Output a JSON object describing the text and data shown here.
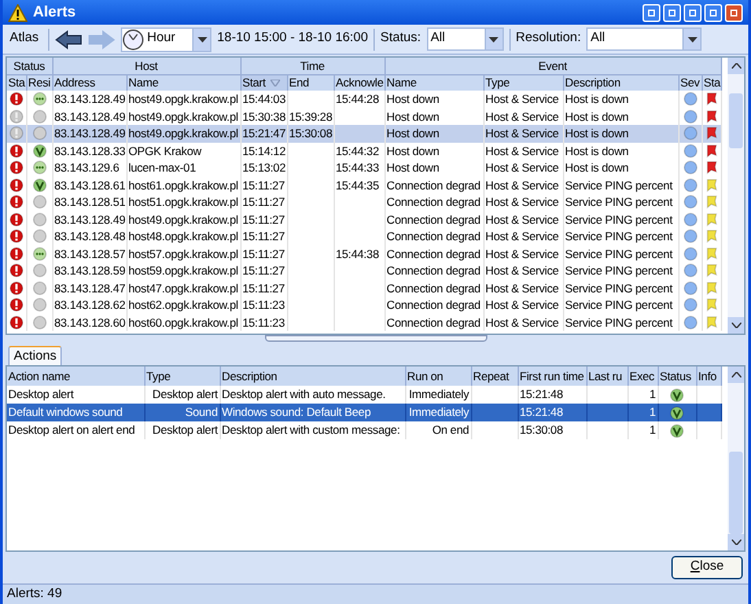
{
  "window": {
    "title": "Alerts"
  },
  "toolbar": {
    "atlas": "Atlas",
    "back_disabled": false,
    "forward_disabled": true,
    "period": "Hour",
    "range": "18-10 15:00 - 18-10 16:00",
    "status_label": "Status:",
    "status_value": "All",
    "resolution_label": "Resolution:",
    "resolution_value": "All"
  },
  "alerts_table": {
    "groups": [
      {
        "label": "Status",
        "columns": [
          {
            "label": "Sta",
            "sorted": false
          },
          {
            "label": "Resi",
            "sorted": false
          }
        ]
      },
      {
        "label": "Host",
        "columns": [
          {
            "label": "Address",
            "sorted": false
          },
          {
            "label": "Name",
            "sorted": false
          }
        ]
      },
      {
        "label": "Time",
        "columns": [
          {
            "label": "Start",
            "sorted": true
          },
          {
            "label": "End",
            "sorted": false
          },
          {
            "label": "Acknowle",
            "sorted": false
          }
        ]
      },
      {
        "label": "Event",
        "columns": [
          {
            "label": "Name",
            "sorted": false
          },
          {
            "label": "Type",
            "sorted": false
          },
          {
            "label": "Description",
            "sorted": false
          },
          {
            "label": "Sev",
            "sorted": false
          },
          {
            "label": "Sta",
            "sorted": false
          }
        ]
      }
    ],
    "rows": [
      {
        "status": {
          "kind": "critical"
        },
        "resolution": {
          "kind": "acknowledged"
        },
        "address": "83.143.128.49",
        "name": "host49.opgk.krakow.pl",
        "start": "15:44:03",
        "acknowledged": "15:44:28",
        "event": "Host down",
        "type": "Host & Service",
        "description": "Host is down",
        "state": {
          "kind": "down"
        },
        "selected": false
      },
      {
        "status": {
          "kind": "inactive"
        },
        "resolution": {
          "kind": "none"
        },
        "address": "83.143.128.49",
        "name": "host49.opgk.krakow.pl",
        "start": "15:30:38",
        "end": "15:39:28",
        "event": "Host down",
        "type": "Host & Service",
        "description": "Host is down",
        "state": {
          "kind": "down"
        },
        "selected": false
      },
      {
        "status": {
          "kind": "inactive"
        },
        "resolution": {
          "kind": "none"
        },
        "address": "83.143.128.49",
        "name": "host49.opgk.krakow.pl",
        "start": "15:21:47",
        "end": "15:30:08",
        "event": "Host down",
        "type": "Host & Service",
        "description": "Host is down",
        "state": {
          "kind": "down"
        },
        "selected": true
      },
      {
        "status": {
          "kind": "critical"
        },
        "resolution": {
          "kind": "ok"
        },
        "address": "83.143.128.33",
        "name": "OPGK Krakow",
        "start": "15:14:12",
        "acknowledged": "15:44:32",
        "event": "Host down",
        "type": "Host & Service",
        "description": "Host is down",
        "state": {
          "kind": "down"
        },
        "selected": false
      },
      {
        "status": {
          "kind": "critical"
        },
        "resolution": {
          "kind": "acknowledged"
        },
        "address": "83.143.129.6",
        "name": "lucen-max-01",
        "start": "15:13:02",
        "acknowledged": "15:44:33",
        "event": "Host down",
        "type": "Host & Service",
        "description": "Host is down",
        "state": {
          "kind": "down"
        },
        "selected": false
      },
      {
        "status": {
          "kind": "critical"
        },
        "resolution": {
          "kind": "ok"
        },
        "address": "83.143.128.61",
        "name": "host61.opgk.krakow.pl",
        "start": "15:11:27",
        "acknowledged": "15:44:35",
        "event": "Connection degrad",
        "type": "Host & Service",
        "description": "Service PING percent",
        "state": {
          "kind": "degraded"
        },
        "selected": false
      },
      {
        "status": {
          "kind": "critical"
        },
        "resolution": {
          "kind": "none"
        },
        "address": "83.143.128.51",
        "name": "host51.opgk.krakow.pl",
        "start": "15:11:27",
        "event": "Connection degrad",
        "type": "Host & Service",
        "description": "Service PING percent",
        "state": {
          "kind": "degraded"
        },
        "selected": false
      },
      {
        "status": {
          "kind": "critical"
        },
        "resolution": {
          "kind": "none"
        },
        "address": "83.143.128.49",
        "name": "host49.opgk.krakow.pl",
        "start": "15:11:27",
        "event": "Connection degrad",
        "type": "Host & Service",
        "description": "Service PING percent",
        "state": {
          "kind": "degraded"
        },
        "selected": false
      },
      {
        "status": {
          "kind": "critical"
        },
        "resolution": {
          "kind": "none"
        },
        "address": "83.143.128.48",
        "name": "host48.opgk.krakow.pl",
        "start": "15:11:27",
        "event": "Connection degrad",
        "type": "Host & Service",
        "description": "Service PING percent",
        "state": {
          "kind": "degraded"
        },
        "selected": false
      },
      {
        "status": {
          "kind": "critical"
        },
        "resolution": {
          "kind": "acknowledged"
        },
        "address": "83.143.128.57",
        "name": "host57.opgk.krakow.pl",
        "start": "15:11:27",
        "acknowledged": "15:44:38",
        "event": "Connection degrad",
        "type": "Host & Service",
        "description": "Service PING percent",
        "state": {
          "kind": "degraded"
        },
        "selected": false
      },
      {
        "status": {
          "kind": "critical"
        },
        "resolution": {
          "kind": "none"
        },
        "address": "83.143.128.59",
        "name": "host59.opgk.krakow.pl",
        "start": "15:11:27",
        "event": "Connection degrad",
        "type": "Host & Service",
        "description": "Service PING percent",
        "state": {
          "kind": "degraded"
        },
        "selected": false
      },
      {
        "status": {
          "kind": "critical"
        },
        "resolution": {
          "kind": "none"
        },
        "address": "83.143.128.47",
        "name": "host47.opgk.krakow.pl",
        "start": "15:11:27",
        "event": "Connection degrad",
        "type": "Host & Service",
        "description": "Service PING percent",
        "state": {
          "kind": "degraded"
        },
        "selected": false
      },
      {
        "status": {
          "kind": "critical"
        },
        "resolution": {
          "kind": "none"
        },
        "address": "83.143.128.62",
        "name": "host62.opgk.krakow.pl",
        "start": "15:11:23",
        "event": "Connection degrad",
        "type": "Host & Service",
        "description": "Service PING percent",
        "state": {
          "kind": "degraded"
        },
        "selected": false
      },
      {
        "status": {
          "kind": "critical"
        },
        "resolution": {
          "kind": "none"
        },
        "address": "83.143.128.60",
        "name": "host60.opgk.krakow.pl",
        "start": "15:11:23",
        "event": "Connection degrad",
        "type": "Host & Service",
        "description": "Service PING percent",
        "state": {
          "kind": "degraded"
        },
        "selected": false
      }
    ]
  },
  "tabs": [
    {
      "label": "Actions",
      "selected": true
    }
  ],
  "actions_table": {
    "columns": [
      "Action name",
      "Type",
      "Description",
      "Run on",
      "Repeat",
      "First run time",
      "Last ru",
      "Exec",
      "Status",
      "Info"
    ],
    "rows": [
      {
        "name": "Desktop alert",
        "type": "Desktop alert",
        "description": "Desktop alert with auto message.",
        "run_on": "Immediately",
        "first_run": "15:21:48",
        "exec": "1",
        "status": {
          "kind": "ok"
        },
        "selected": false
      },
      {
        "name": "Default windows sound",
        "type": "Sound",
        "description": "Windows sound: Default Beep",
        "run_on": "Immediately",
        "first_run": "15:21:48",
        "exec": "1",
        "status": {
          "kind": "ok"
        },
        "selected": true
      },
      {
        "name": "Desktop alert on alert end",
        "type": "Desktop alert",
        "description": "Desktop alert with custom message:",
        "run_on": "On end",
        "first_run": "15:30:08",
        "exec": "1",
        "status": {
          "kind": "ok"
        },
        "selected": false
      }
    ]
  },
  "close_button": "Close",
  "status_bar": "Alerts: 49"
}
